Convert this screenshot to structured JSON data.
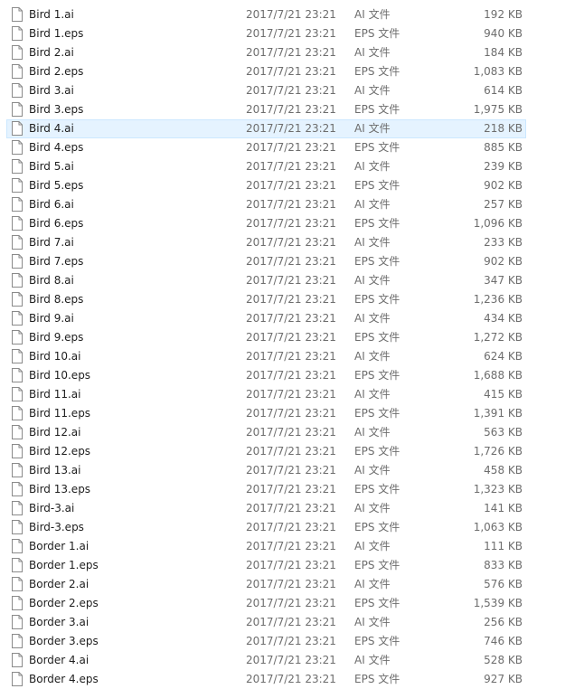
{
  "files": [
    {
      "name": "Bird 1.ai",
      "date": "2017/7/21 23:21",
      "type": "AI 文件",
      "size": "192 KB"
    },
    {
      "name": "Bird 1.eps",
      "date": "2017/7/21 23:21",
      "type": "EPS 文件",
      "size": "940 KB"
    },
    {
      "name": "Bird 2.ai",
      "date": "2017/7/21 23:21",
      "type": "AI 文件",
      "size": "184 KB"
    },
    {
      "name": "Bird 2.eps",
      "date": "2017/7/21 23:21",
      "type": "EPS 文件",
      "size": "1,083 KB"
    },
    {
      "name": "Bird 3.ai",
      "date": "2017/7/21 23:21",
      "type": "AI 文件",
      "size": "614 KB"
    },
    {
      "name": "Bird 3.eps",
      "date": "2017/7/21 23:21",
      "type": "EPS 文件",
      "size": "1,975 KB"
    },
    {
      "name": "Bird 4.ai",
      "date": "2017/7/21 23:21",
      "type": "AI 文件",
      "size": "218 KB",
      "selected": true
    },
    {
      "name": "Bird 4.eps",
      "date": "2017/7/21 23:21",
      "type": "EPS 文件",
      "size": "885 KB"
    },
    {
      "name": "Bird 5.ai",
      "date": "2017/7/21 23:21",
      "type": "AI 文件",
      "size": "239 KB"
    },
    {
      "name": "Bird 5.eps",
      "date": "2017/7/21 23:21",
      "type": "EPS 文件",
      "size": "902 KB"
    },
    {
      "name": "Bird 6.ai",
      "date": "2017/7/21 23:21",
      "type": "AI 文件",
      "size": "257 KB"
    },
    {
      "name": "Bird 6.eps",
      "date": "2017/7/21 23:21",
      "type": "EPS 文件",
      "size": "1,096 KB"
    },
    {
      "name": "Bird 7.ai",
      "date": "2017/7/21 23:21",
      "type": "AI 文件",
      "size": "233 KB"
    },
    {
      "name": "Bird 7.eps",
      "date": "2017/7/21 23:21",
      "type": "EPS 文件",
      "size": "902 KB"
    },
    {
      "name": "Bird 8.ai",
      "date": "2017/7/21 23:21",
      "type": "AI 文件",
      "size": "347 KB"
    },
    {
      "name": "Bird 8.eps",
      "date": "2017/7/21 23:21",
      "type": "EPS 文件",
      "size": "1,236 KB"
    },
    {
      "name": "Bird 9.ai",
      "date": "2017/7/21 23:21",
      "type": "AI 文件",
      "size": "434 KB"
    },
    {
      "name": "Bird 9.eps",
      "date": "2017/7/21 23:21",
      "type": "EPS 文件",
      "size": "1,272 KB"
    },
    {
      "name": "Bird 10.ai",
      "date": "2017/7/21 23:21",
      "type": "AI 文件",
      "size": "624 KB"
    },
    {
      "name": "Bird 10.eps",
      "date": "2017/7/21 23:21",
      "type": "EPS 文件",
      "size": "1,688 KB"
    },
    {
      "name": "Bird 11.ai",
      "date": "2017/7/21 23:21",
      "type": "AI 文件",
      "size": "415 KB"
    },
    {
      "name": "Bird 11.eps",
      "date": "2017/7/21 23:21",
      "type": "EPS 文件",
      "size": "1,391 KB"
    },
    {
      "name": "Bird 12.ai",
      "date": "2017/7/21 23:21",
      "type": "AI 文件",
      "size": "563 KB"
    },
    {
      "name": "Bird 12.eps",
      "date": "2017/7/21 23:21",
      "type": "EPS 文件",
      "size": "1,726 KB"
    },
    {
      "name": "Bird 13.ai",
      "date": "2017/7/21 23:21",
      "type": "AI 文件",
      "size": "458 KB"
    },
    {
      "name": "Bird 13.eps",
      "date": "2017/7/21 23:21",
      "type": "EPS 文件",
      "size": "1,323 KB"
    },
    {
      "name": "Bird-3.ai",
      "date": "2017/7/21 23:21",
      "type": "AI 文件",
      "size": "141 KB"
    },
    {
      "name": "Bird-3.eps",
      "date": "2017/7/21 23:21",
      "type": "EPS 文件",
      "size": "1,063 KB"
    },
    {
      "name": "Border 1.ai",
      "date": "2017/7/21 23:21",
      "type": "AI 文件",
      "size": "111 KB"
    },
    {
      "name": "Border 1.eps",
      "date": "2017/7/21 23:21",
      "type": "EPS 文件",
      "size": "833 KB"
    },
    {
      "name": "Border 2.ai",
      "date": "2017/7/21 23:21",
      "type": "AI 文件",
      "size": "576 KB"
    },
    {
      "name": "Border 2.eps",
      "date": "2017/7/21 23:21",
      "type": "EPS 文件",
      "size": "1,539 KB"
    },
    {
      "name": "Border 3.ai",
      "date": "2017/7/21 23:21",
      "type": "AI 文件",
      "size": "256 KB"
    },
    {
      "name": "Border 3.eps",
      "date": "2017/7/21 23:21",
      "type": "EPS 文件",
      "size": "746 KB"
    },
    {
      "name": "Border 4.ai",
      "date": "2017/7/21 23:21",
      "type": "AI 文件",
      "size": "528 KB"
    },
    {
      "name": "Border 4.eps",
      "date": "2017/7/21 23:21",
      "type": "EPS 文件",
      "size": "927 KB"
    }
  ],
  "icon": "file-icon",
  "colors": {
    "selection_bg": "#e5f3ff",
    "selection_border": "#cce8ff",
    "name_text": "#1e1e1e",
    "detail_text": "#6d6d6d"
  }
}
